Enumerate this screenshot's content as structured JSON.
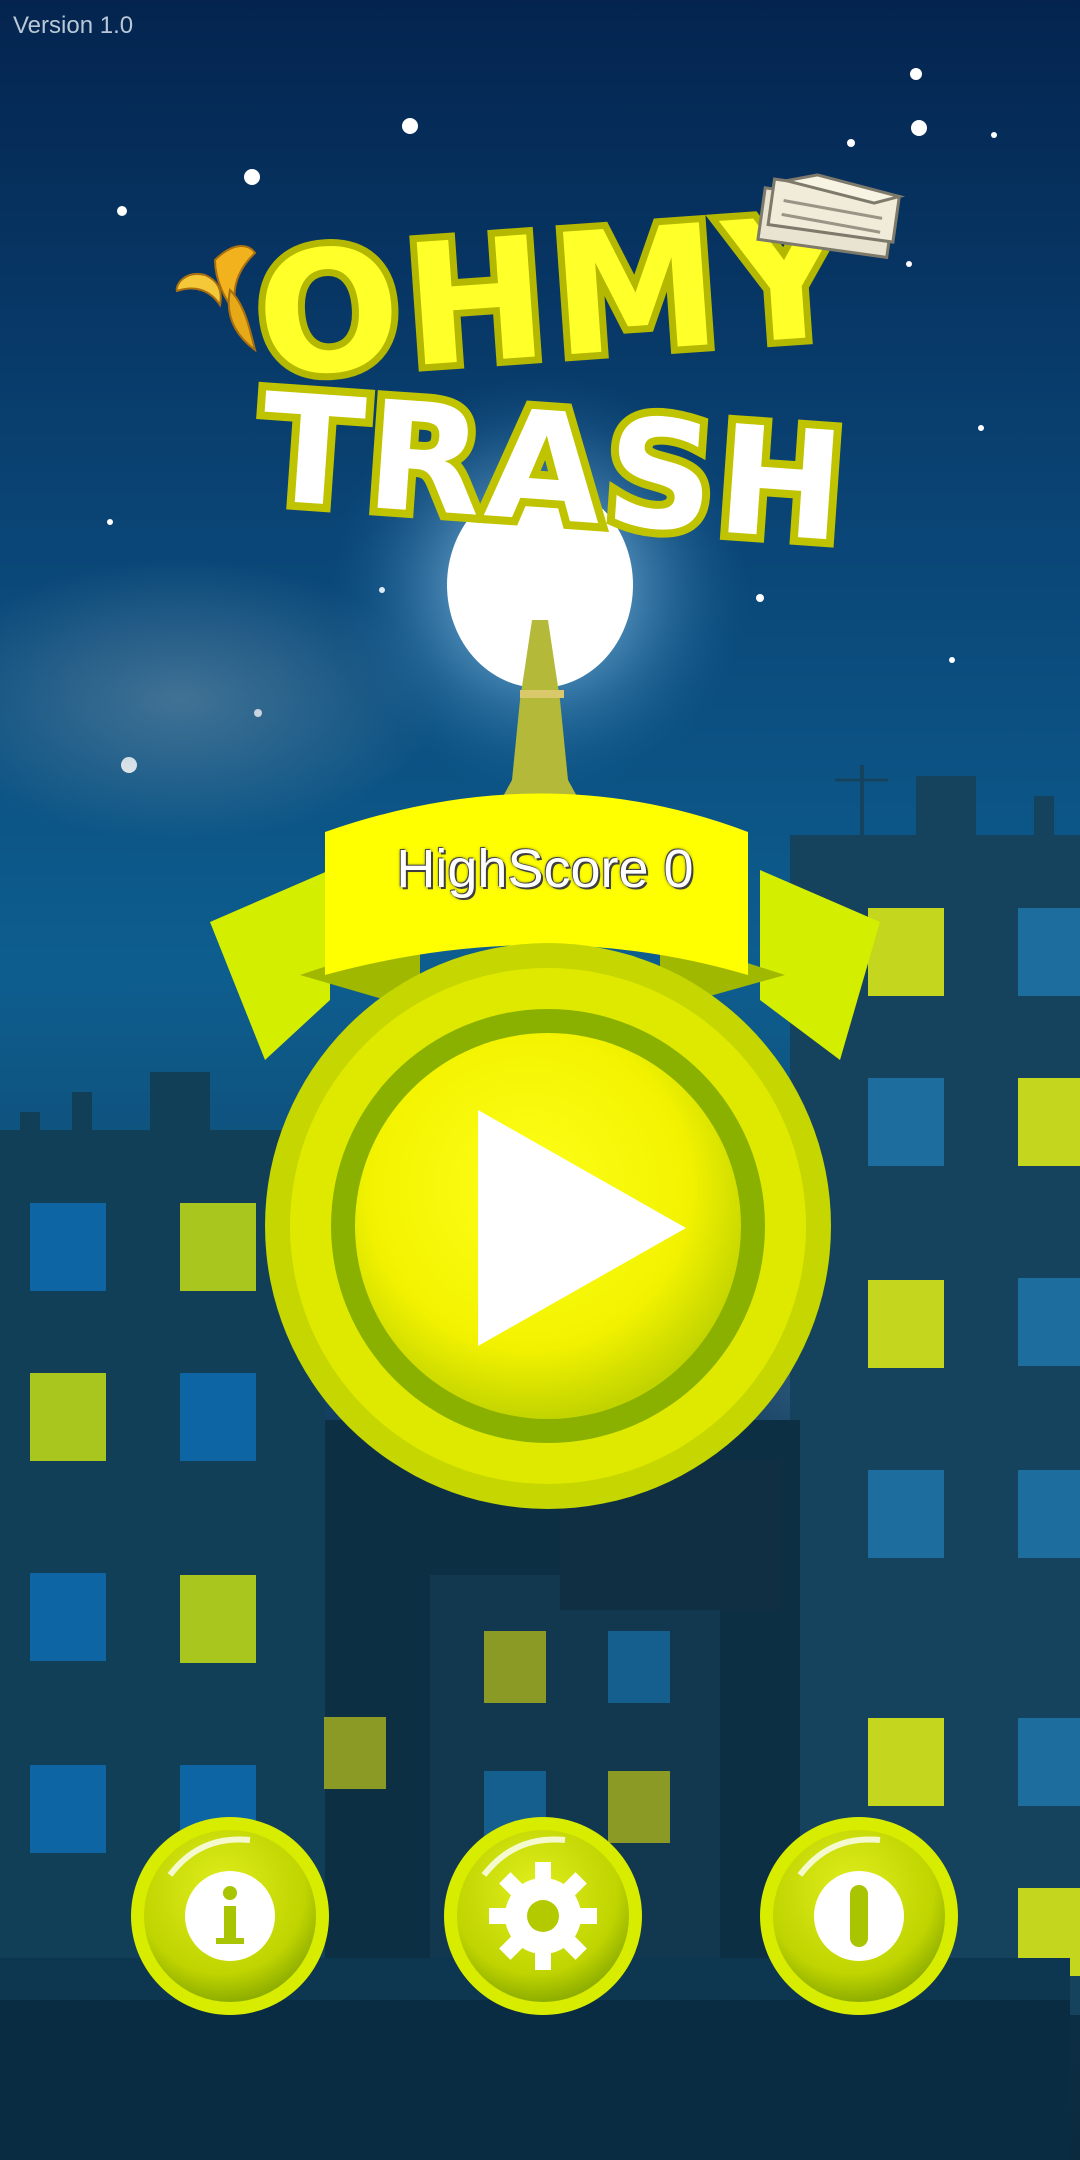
{
  "app": {
    "version_label": "Version 1.0",
    "title_line1": "OHMY",
    "title_line2": "TRASH"
  },
  "highscore": {
    "label": "HighScore",
    "value": "0",
    "text": "HighScore 0"
  },
  "buttons": [
    {
      "name": "play",
      "icon": "play-icon"
    },
    {
      "name": "info",
      "icon": "info-icon"
    },
    {
      "name": "settings",
      "icon": "gear-icon"
    },
    {
      "name": "exit",
      "icon": "exit-icon"
    }
  ],
  "colors": {
    "sky_top": "#052a57",
    "sky_mid": "#0d5d8e",
    "accent_yellow": "#ffff00",
    "button_rim": "#c8d800",
    "button_dark": "#8aac00",
    "building": "#0f3a52",
    "window_blue": "#1a6fa0",
    "window_lit": "#c5d61f"
  }
}
